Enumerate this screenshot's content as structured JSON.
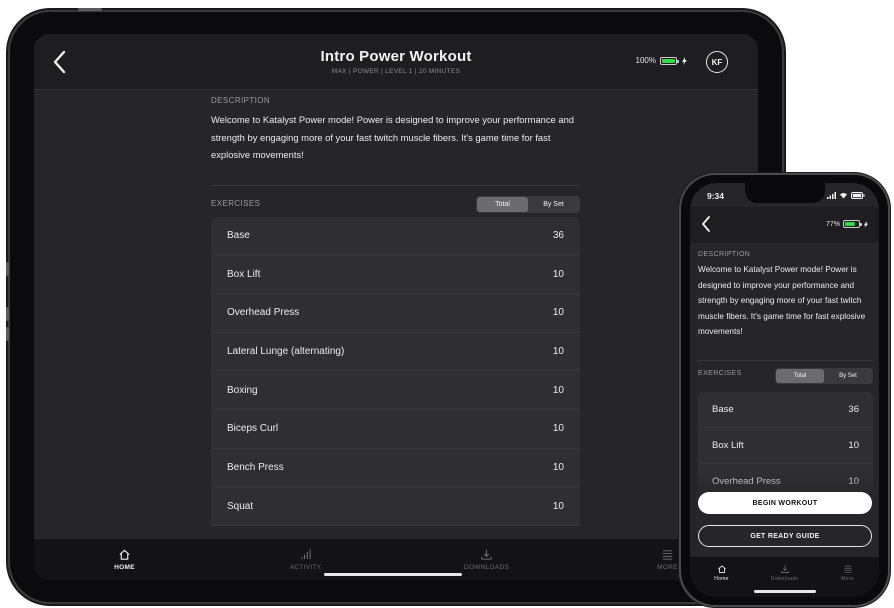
{
  "tablet": {
    "header": {
      "title": "Intro Power Workout",
      "subtitle": "MAX | POWER | LEVEL 1 | 20 MINUTES",
      "battery_text": "100%",
      "battery_level": 1.0,
      "avatar_initials": "KF"
    },
    "description_label": "DESCRIPTION",
    "description": "Welcome to Katalyst Power mode! Power is designed to improve your performance and strength by engaging more of your fast twitch muscle fibers. It's game time for fast explosive movements!",
    "exercises_label": "EXERCISES",
    "segment": {
      "total": "Total",
      "by_set": "By Set",
      "selected": "total"
    },
    "exercises": [
      {
        "name": "Base",
        "count": "36"
      },
      {
        "name": "Box Lift",
        "count": "10"
      },
      {
        "name": "Overhead Press",
        "count": "10"
      },
      {
        "name": "Lateral Lunge (alternating)",
        "count": "10"
      },
      {
        "name": "Boxing",
        "count": "10"
      },
      {
        "name": "Biceps Curl",
        "count": "10"
      },
      {
        "name": "Bench Press",
        "count": "10"
      },
      {
        "name": "Squat",
        "count": "10"
      }
    ],
    "nav": {
      "home": "HOME",
      "activity": "ACTIVITY",
      "downloads": "DOWNLOADS",
      "more": "MORE",
      "active": "home"
    }
  },
  "phone": {
    "status": {
      "time": "9:34"
    },
    "header": {
      "battery_text": "77%",
      "battery_level": 0.77
    },
    "description_label": "DESCRIPTION",
    "description": "Welcome to Katalyst Power mode! Power is designed to improve your performance and strength by engaging more of your fast twitch muscle fibers. It's game time for fast explosive movements!",
    "exercises_label": "EXERCISES",
    "segment": {
      "total": "Total",
      "by_set": "By Set"
    },
    "exercises": [
      {
        "name": "Base",
        "count": "36"
      },
      {
        "name": "Box Lift",
        "count": "10"
      },
      {
        "name": "Overhead Press",
        "count": "10"
      }
    ],
    "begin_label": "BEGIN WORKOUT",
    "guide_label": "GET READY GUIDE",
    "nav": {
      "home": "Home",
      "downloads": "Downloads",
      "more": "More"
    }
  },
  "colors": {
    "background": "#26262a",
    "accent_battery": "#32d74b",
    "text": "#ececec",
    "muted": "#9a9aa0"
  }
}
